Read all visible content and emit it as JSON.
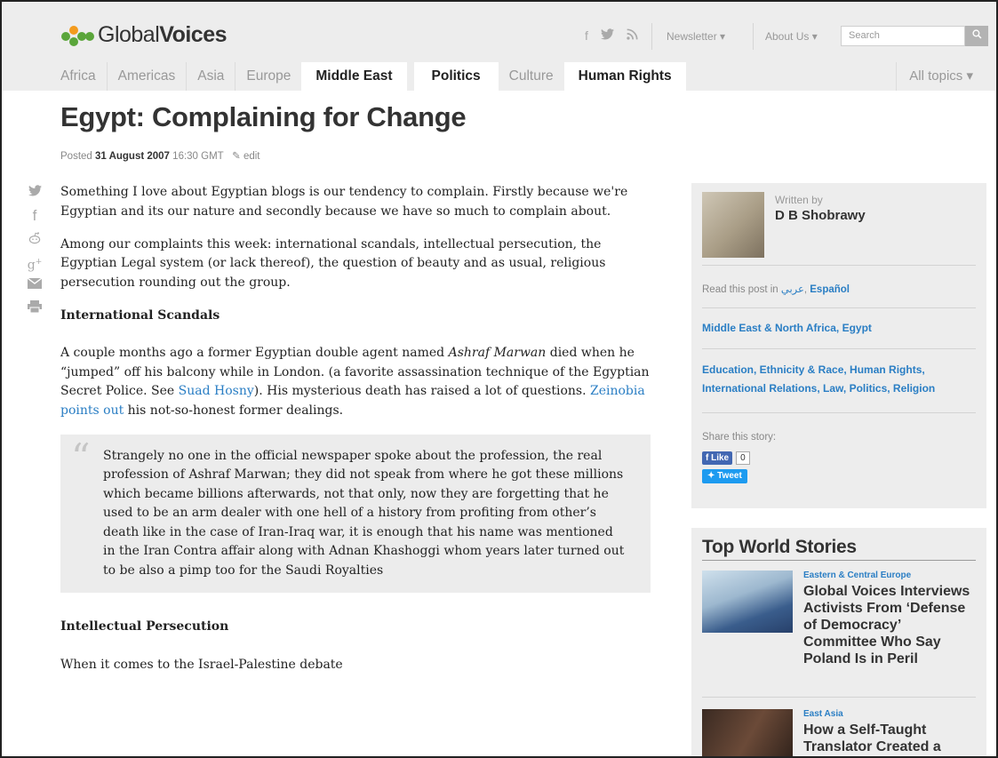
{
  "header": {
    "logo_light": "Global",
    "logo_bold": "Voices",
    "newsletter": "Newsletter ▾",
    "about": "About Us ▾",
    "search_placeholder": "Search",
    "social_icons": [
      "facebook-icon",
      "twitter-icon",
      "rss-icon"
    ]
  },
  "nav": {
    "tabs": [
      {
        "label": "Africa",
        "active": false
      },
      {
        "label": "Americas",
        "active": false
      },
      {
        "label": "Asia",
        "active": false
      },
      {
        "label": "Europe",
        "active": false
      },
      {
        "label": "Middle East",
        "active": true
      },
      {
        "label": "Politics",
        "active": true
      },
      {
        "label": "Culture",
        "active": false
      },
      {
        "label": "Human Rights",
        "active": true
      }
    ],
    "all_topics": "All topics ▾"
  },
  "article": {
    "title": "Egypt: Complaining for Change",
    "posted_label": "Posted",
    "date": "31 August 2007",
    "time": "16:30 GMT",
    "edit": "edit",
    "p1": "Something I love about Egyptian blogs is our tendency to complain. Firstly because we're Egyptian and its our nature and secondly because we have so much to complain about.",
    "p2": "Among our complaints this week: international scandals, intellectual persecution, the Egyptian Legal system (or lack thereof), the question of beauty and as usual, religious persecution rounding out the group.",
    "h_scandals": "International Scandals",
    "p3_a": "A couple months ago a former Egyptian double agent named ",
    "p3_name": "Ashraf Marwan",
    "p3_b": " died when he “jumped” off his balcony while in London. (a favorite assassination technique of the Egyptian Secret Police. See ",
    "p3_link1": "Suad Hosny",
    "p3_c": "). His mysterious death has raised a lot of questions. ",
    "p3_link2": "Zeinobia points out",
    "p3_d": " his not-so-honest former dealings.",
    "quote": "Strangely no one in the official newspaper spoke about the profession, the real profession of Ashraf Marwan; they did not speak from where he got these millions which became billions afterwards, not that only, now they are forgetting that he used to be an arm dealer with one hell of a history from profiting from other’s death like in the case of Iran-Iraq war, it is enough that his name was mentioned in the Iran Contra affair along with Adnan Khashoggi whom years later turned out to be also a pimp too for the Saudi Royalties",
    "h_persecution": "Intellectual Persecution",
    "p4": "When it comes to the Israel-Palestine debate"
  },
  "share_icons": [
    "twitter-icon",
    "facebook-icon",
    "reddit-icon",
    "google-plus-icon",
    "email-icon",
    "print-icon"
  ],
  "author_box": {
    "written_by": "Written by",
    "author": "D B Shobrawy",
    "read_in_label": "Read this post in ",
    "lang_ar": "عربي",
    "lang_sep": ", ",
    "lang_es": "Español",
    "regions": "Middle East & North Africa, Egypt",
    "topics": "Education, Ethnicity & Race, Human Rights, International Relations, Law, Politics, Religion",
    "share_label": "Share this story:",
    "like_label": "Like",
    "like_count": "0",
    "tweet_label": "Tweet"
  },
  "top_stories": {
    "heading": "Top World Stories",
    "items": [
      {
        "category": "Eastern & Central Europe",
        "title": "Global Voices Interviews Activists From ‘Defense of Democracy’ Committee Who Say Poland Is in Peril"
      },
      {
        "category": "East Asia",
        "title": "How a Self-Taught Translator Created a"
      }
    ]
  },
  "colors": {
    "link": "#2a7ec4",
    "logo_green": "#5aa53a",
    "header_bg": "#ededed"
  }
}
